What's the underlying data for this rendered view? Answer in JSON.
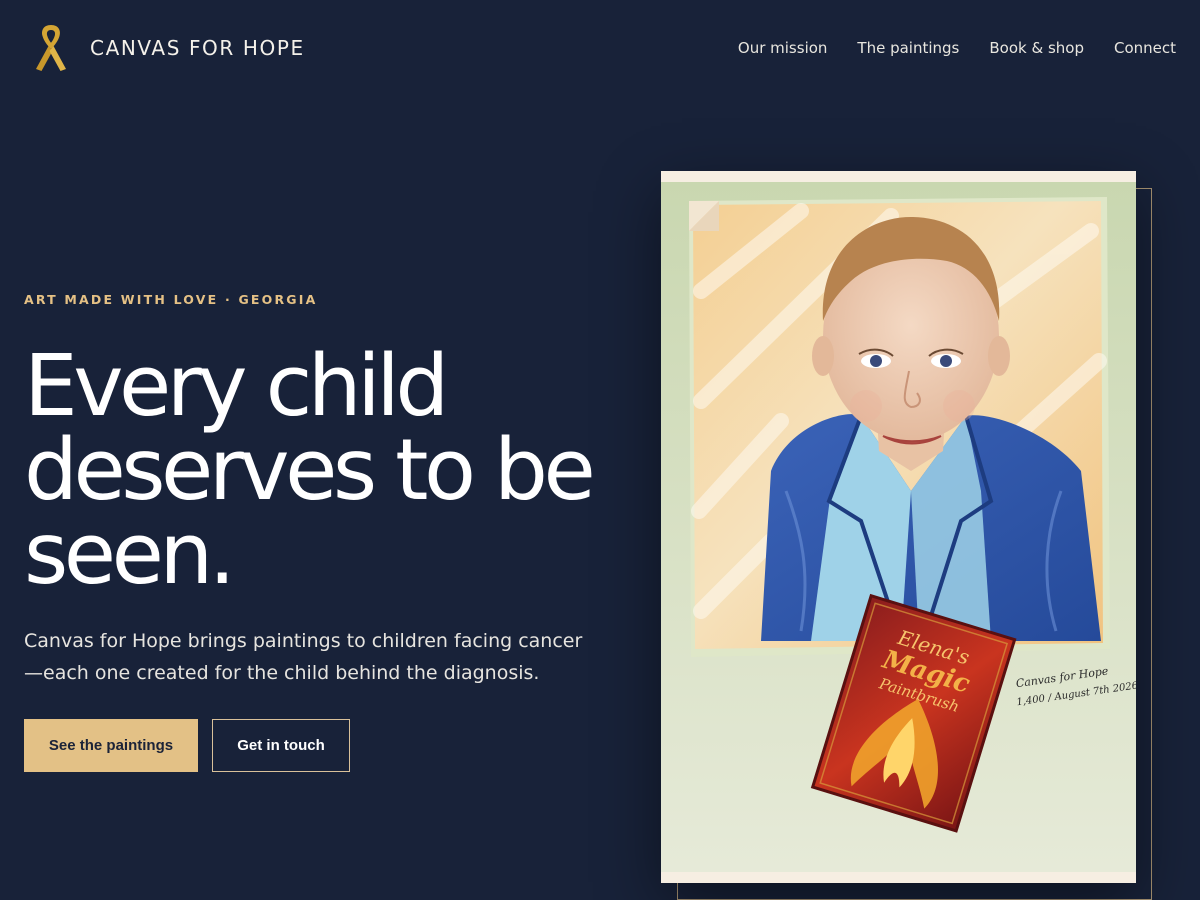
{
  "brand": {
    "name": "CANVAS FOR HOPE",
    "logo_icon": "awareness-ribbon-icon",
    "logo_color": "#d4a534"
  },
  "nav": {
    "items": [
      "Our mission",
      "The paintings",
      "Book & shop",
      "Connect"
    ]
  },
  "hero": {
    "eyebrow": "ART MADE WITH LOVE · GEORGIA",
    "headline_lines": [
      "Every child",
      "deserves to be",
      "seen."
    ],
    "lede": "Canvas for Hope brings paintings to children facing cancer—each one created for the child behind the diagnosis.",
    "primary_cta": "See the paintings",
    "secondary_cta": "Get in touch"
  },
  "painting": {
    "book_title_lines": [
      "Elena's",
      "Magic",
      "Paintbrush"
    ],
    "signature_lines": [
      "Canvas for Hope",
      "1,400 / August 7th 2026"
    ]
  },
  "colors": {
    "background": "#182239",
    "accent": "#e3c186",
    "text": "#ffffff"
  }
}
